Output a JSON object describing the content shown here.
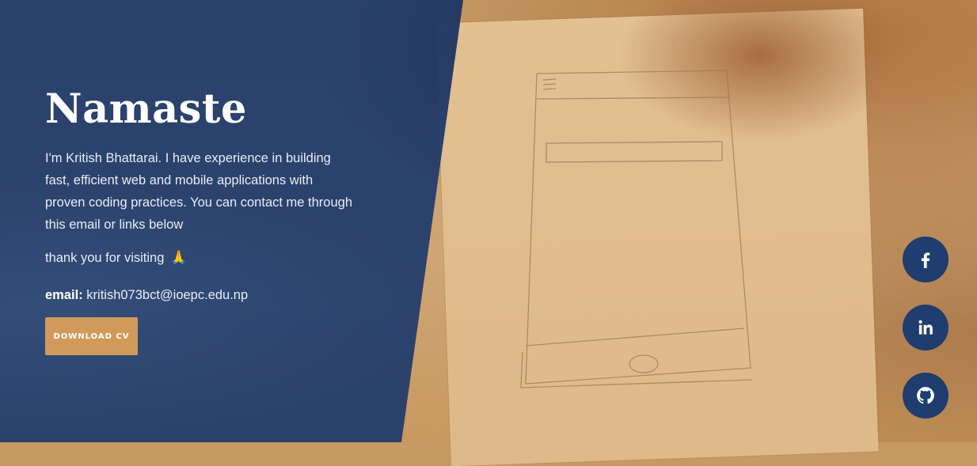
{
  "hero": {
    "title": "Namaste",
    "intro": "I'm Kritish Bhattarai. I have experience in building fast, efficient web and mobile applications with proven coding practices. You can contact me through this email or links below",
    "thanks": "thank you for visiting",
    "thanks_emoji": "🙏",
    "email_label": "email:",
    "email_value": "kritish073bct@ioepc.edu.np",
    "cv_button": "DOWNLOAD CV"
  },
  "social": [
    {
      "icon": "facebook-icon"
    },
    {
      "icon": "linkedin-icon"
    },
    {
      "icon": "github-icon"
    }
  ],
  "colors": {
    "overlay": "#1e3a6c",
    "accent": "#d19a5b",
    "social_bg": "#1f3d6e"
  }
}
